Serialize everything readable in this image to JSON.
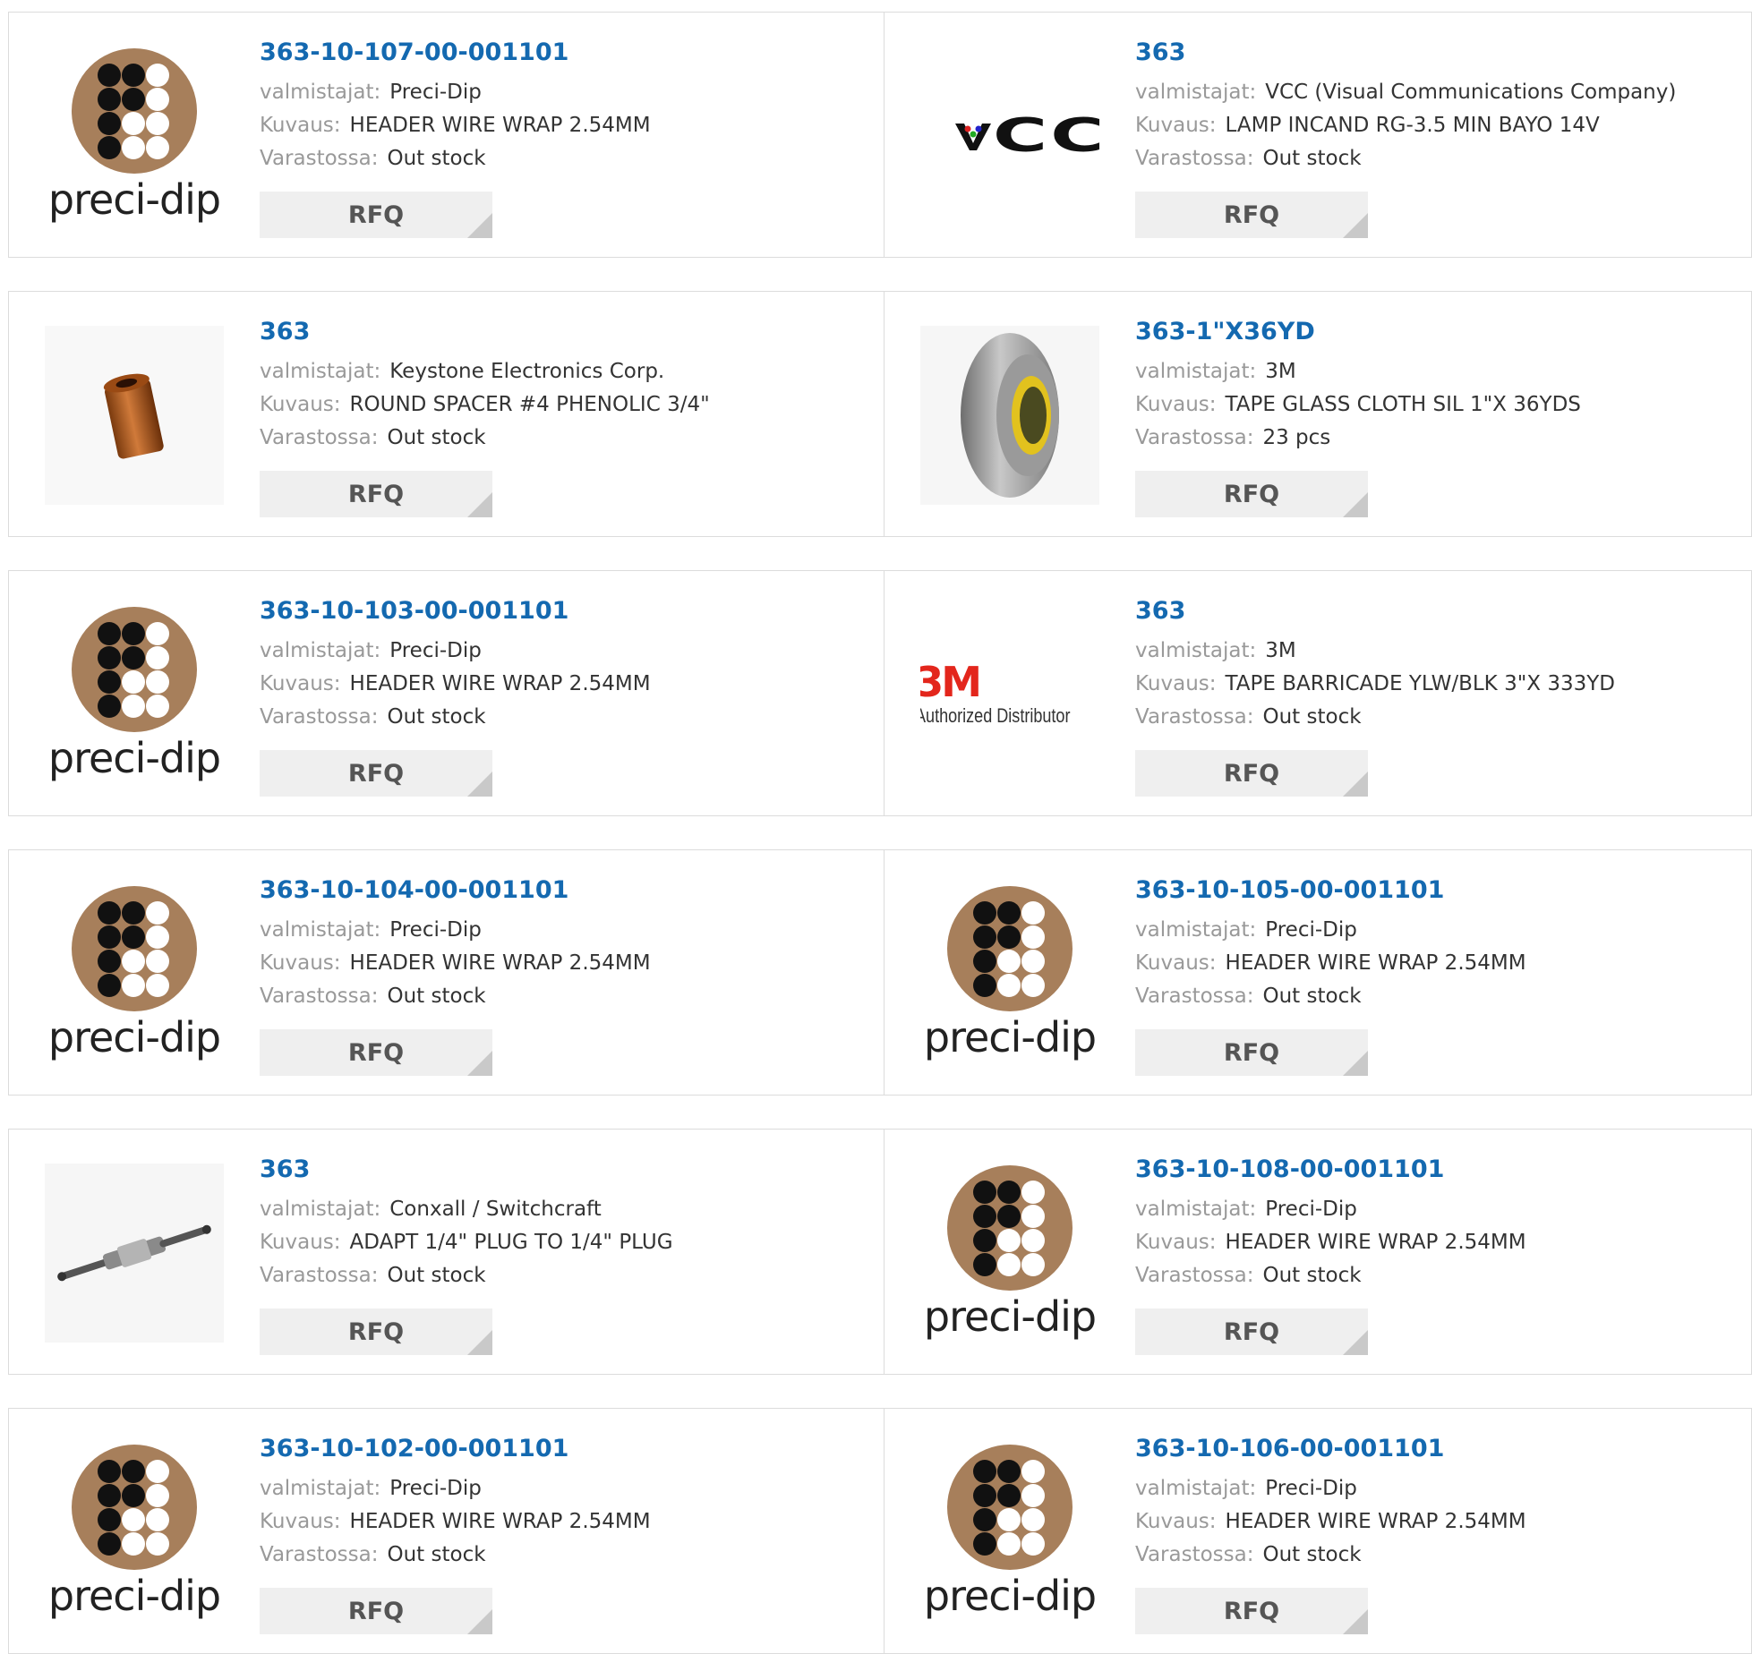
{
  "labels": {
    "manufacturer": "valmistajat:",
    "description": "Kuvaus:",
    "stock": "Varastossa:"
  },
  "products": [
    {
      "pn": "363-10-107-00-001101",
      "manufacturer": "Preci-Dip",
      "description": "HEADER WIRE WRAP 2.54MM",
      "stock": "Out stock",
      "image": "preci-dip-logo",
      "button": "RFQ"
    },
    {
      "pn": "363",
      "manufacturer": "VCC (Visual Communications Company)",
      "description": "LAMP INCAND RG-3.5 MIN BAYO 14V",
      "stock": "Out stock",
      "image": "vcc-logo",
      "button": "RFQ"
    },
    {
      "pn": "363",
      "manufacturer": "Keystone Electronics Corp.",
      "description": "ROUND SPACER #4 PHENOLIC 3/4\"",
      "stock": "Out stock",
      "image": "spacer-photo",
      "button": "RFQ"
    },
    {
      "pn": "363-1\"X36YD",
      "manufacturer": "3M",
      "description": "TAPE GLASS CLOTH SIL 1\"X 36YDS",
      "stock": "23 pcs",
      "image": "tape-roll-photo",
      "button": "RFQ"
    },
    {
      "pn": "363-10-103-00-001101",
      "manufacturer": "Preci-Dip",
      "description": "HEADER WIRE WRAP 2.54MM",
      "stock": "Out stock",
      "image": "preci-dip-logo",
      "button": "RFQ"
    },
    {
      "pn": "363",
      "manufacturer": "3M",
      "description": "TAPE BARRICADE YLW/BLK 3\"X 333YD",
      "stock": "Out stock",
      "image": "3m-authorized-distributor-logo",
      "button": "RFQ"
    },
    {
      "pn": "363-10-104-00-001101",
      "manufacturer": "Preci-Dip",
      "description": "HEADER WIRE WRAP 2.54MM",
      "stock": "Out stock",
      "image": "preci-dip-logo",
      "button": "RFQ"
    },
    {
      "pn": "363-10-105-00-001101",
      "manufacturer": "Preci-Dip",
      "description": "HEADER WIRE WRAP 2.54MM",
      "stock": "Out stock",
      "image": "preci-dip-logo",
      "button": "RFQ"
    },
    {
      "pn": "363",
      "manufacturer": "Conxall / Switchcraft",
      "description": "ADAPT 1/4\" PLUG TO 1/4\" PLUG",
      "stock": "Out stock",
      "image": "plug-adapter-photo",
      "button": "RFQ"
    },
    {
      "pn": "363-10-108-00-001101",
      "manufacturer": "Preci-Dip",
      "description": "HEADER WIRE WRAP 2.54MM",
      "stock": "Out stock",
      "image": "preci-dip-logo",
      "button": "RFQ"
    },
    {
      "pn": "363-10-102-00-001101",
      "manufacturer": "Preci-Dip",
      "description": "HEADER WIRE WRAP 2.54MM",
      "stock": "Out stock",
      "image": "preci-dip-logo",
      "button": "RFQ"
    },
    {
      "pn": "363-10-106-00-001101",
      "manufacturer": "Preci-Dip",
      "description": "HEADER WIRE WRAP 2.54MM",
      "stock": "Out stock",
      "image": "preci-dip-logo",
      "button": "RFQ"
    }
  ],
  "logo_text": {
    "preci_dip": "preci-dip",
    "vcc": "VCC",
    "vcc_tm": "™",
    "three_m": "3M",
    "three_m_sub": "Authorized Distributor"
  },
  "colors": {
    "link": "#1469b0",
    "preci_brown": "#a77f5b",
    "three_m_red": "#e3261c"
  }
}
